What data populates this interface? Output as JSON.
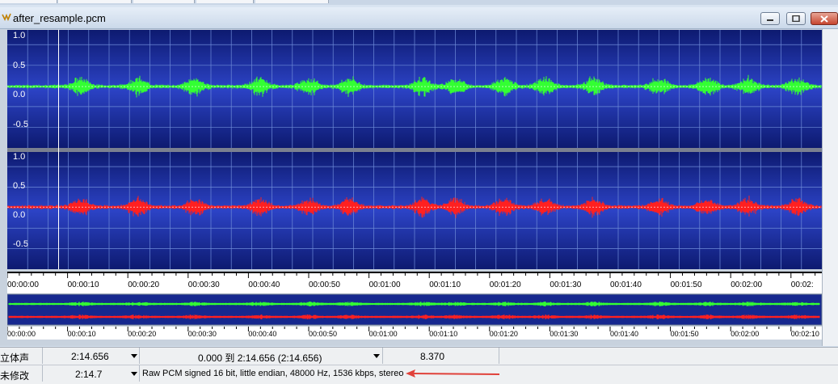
{
  "window": {
    "title": "after_resample.pcm"
  },
  "icons": {
    "app": "waveform-file-icon",
    "minimize": "minimize-icon",
    "maximize": "maximize-icon",
    "close": "close-icon"
  },
  "colors": {
    "wave_bg_top": "#0d1a70",
    "wave_bg_mid": "#2c43c6",
    "left_channel": "#33ff33",
    "right_channel": "#ff2020",
    "grid": "#6e8bd8"
  },
  "channels": [
    {
      "y_labels": [
        "1.0",
        "0.5",
        "0.0",
        "-0.5"
      ]
    },
    {
      "y_labels": [
        "1.0",
        "0.5",
        "0.0",
        "-0.5"
      ]
    }
  ],
  "timeline": {
    "ticks": [
      "00:00:00",
      "00:00:10",
      "00:00:20",
      "00:00:30",
      "00:00:40",
      "00:00:50",
      "00:01:00",
      "00:01:10",
      "00:01:20",
      "00:01:30",
      "00:01:40",
      "00:01:50",
      "00:02:00",
      "00:02:"
    ]
  },
  "overview_timeline": {
    "ticks": [
      "00:00:00",
      "00:00:10",
      "00:00:20",
      "00:00:30",
      "00:00:40",
      "00:00:50",
      "00:01:00",
      "00:01:10",
      "00:01:20",
      "00:01:30",
      "00:01:40",
      "00:01:50",
      "00:02:00",
      "00:02:10"
    ]
  },
  "status": {
    "channel_mode": "立体声",
    "length": "2:14.656",
    "selection": "0.000 到 2:14.656 (2:14.656)",
    "value": "8.370",
    "modified": "未修改",
    "length_short": "2:14.7",
    "format": "Raw PCM signed 16 bit, little endian, 48000 Hz, 1536 kbps, stereo"
  }
}
